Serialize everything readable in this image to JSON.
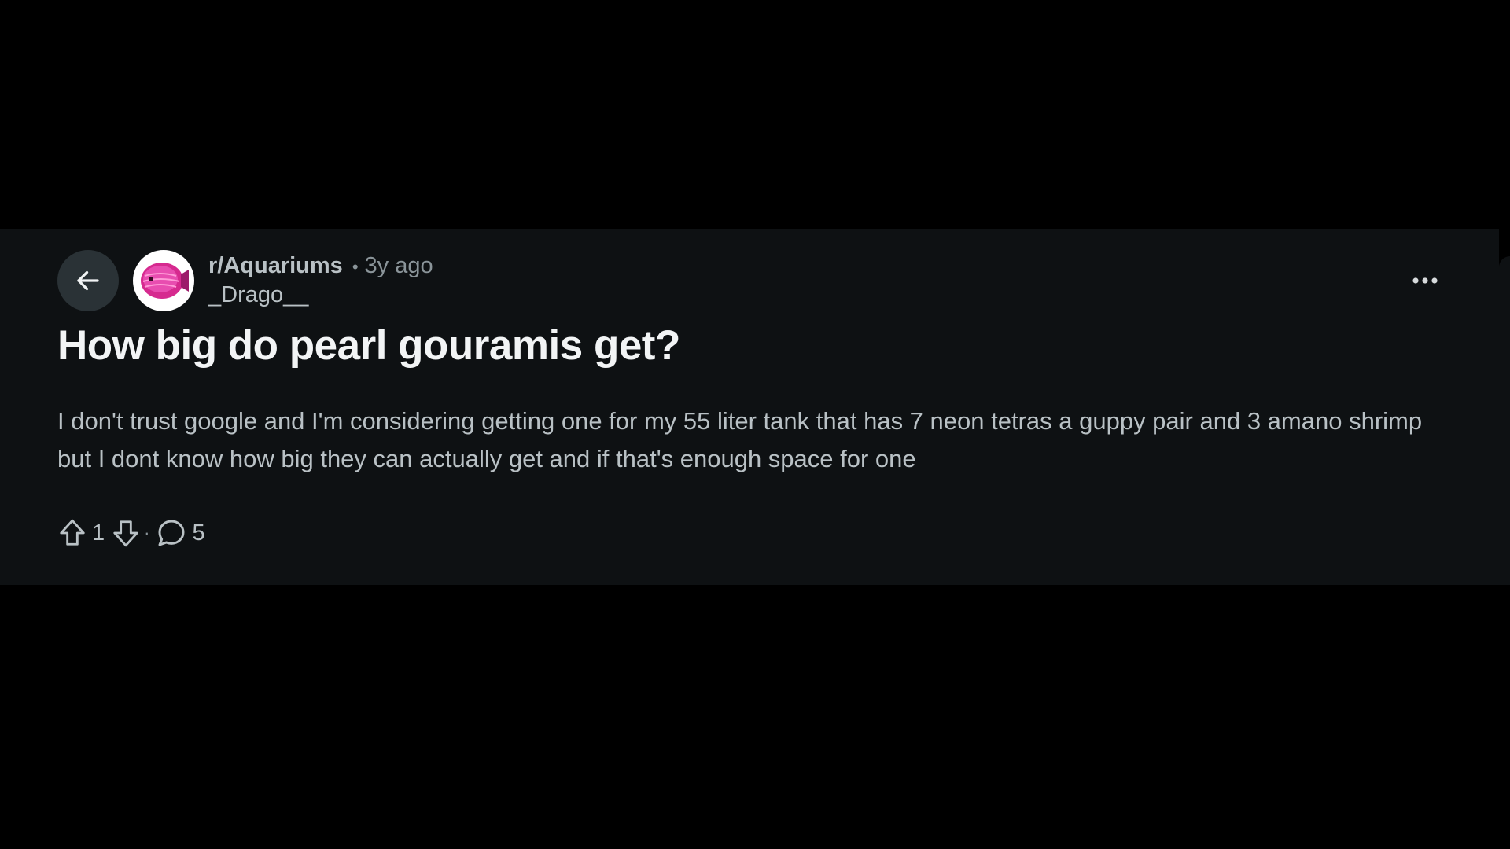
{
  "post": {
    "subreddit": "r/Aquariums",
    "separator": "•",
    "time_ago": "3y ago",
    "author": "_Drago__",
    "title": "How big do pearl gouramis get?",
    "body": "I don't trust google and I'm considering getting one for my 55 liter tank that has 7 neon tetras a guppy pair and 3 amano shrimp but I dont know how big they can actually get and if that's enough space for one",
    "vote_count": "1",
    "actions_separator": "·",
    "comment_count": "5"
  },
  "icons": {
    "back": "arrow-left-icon",
    "avatar": "fish-icon",
    "more": "more-horizontal-icon",
    "upvote": "arrow-up-outline-icon",
    "downvote": "arrow-down-outline-icon",
    "comments": "speech-bubble-icon"
  },
  "colors": {
    "page_background": "#000000",
    "card_background": "#0e1113",
    "title_text": "#f2f4f5",
    "body_text": "#b9c1c5",
    "muted_text": "#8a9499",
    "back_button_bg": "#2a3236",
    "avatar_accent": "#e0309b"
  }
}
